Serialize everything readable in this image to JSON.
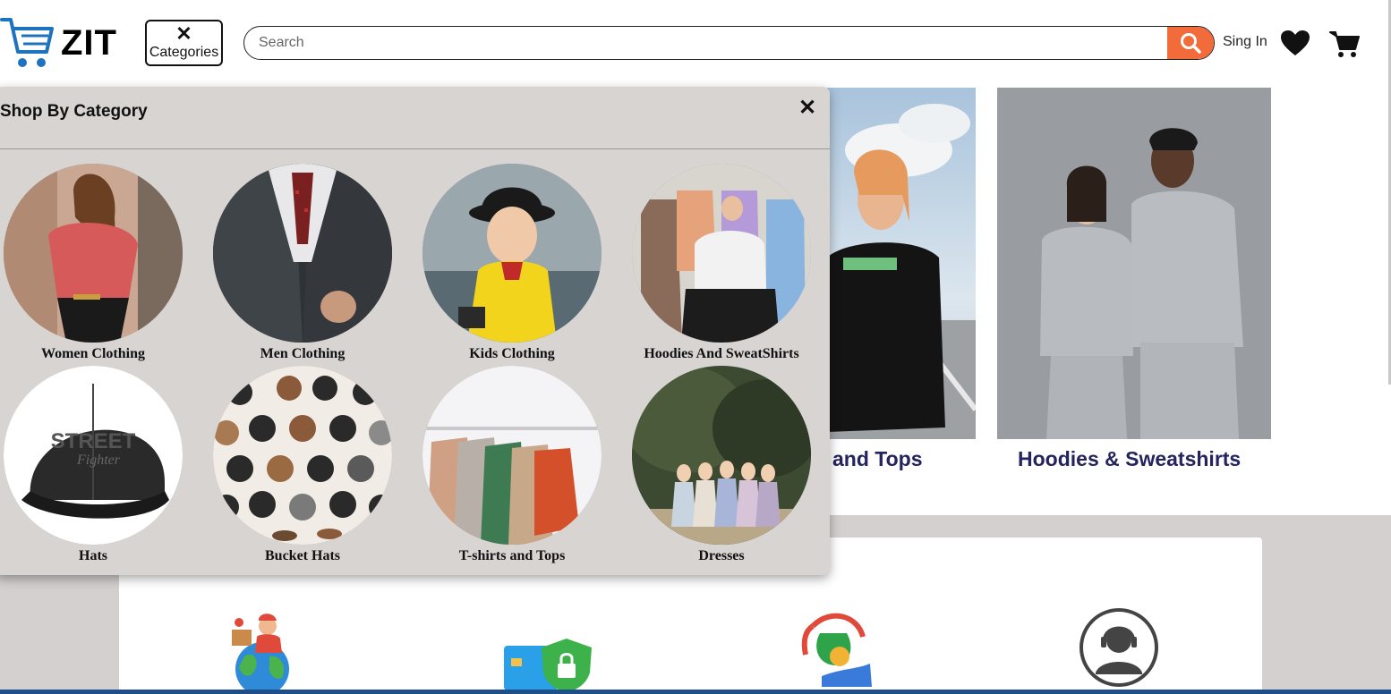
{
  "header": {
    "logo_text": "ZIT",
    "categories_close": "✕",
    "categories_label": "Categories",
    "search_placeholder": "Search",
    "search_value": "",
    "signin_label": "Sing In"
  },
  "background_cards": [
    {
      "title": "and Tops"
    },
    {
      "title": "Hoodies & Sweatshirts"
    }
  ],
  "category_panel": {
    "title": "Shop By Category",
    "close": "✕",
    "items": [
      {
        "label": "Women Clothing"
      },
      {
        "label": "Men Clothing"
      },
      {
        "label": "Kids Clothing"
      },
      {
        "label": "Hoodies And SweatShirts"
      },
      {
        "label": "Hats"
      },
      {
        "label": "Bucket Hats"
      },
      {
        "label": "T-shirts and Tops"
      },
      {
        "label": "Dresses"
      }
    ]
  },
  "hat_print": {
    "line1": "STREET",
    "line2": "Fighter"
  },
  "features": [
    {
      "icon": "delivery-globe-icon"
    },
    {
      "icon": "secure-payment-icon"
    },
    {
      "icon": "money-back-icon"
    },
    {
      "icon": "support-agent-icon"
    }
  ],
  "colors": {
    "accent": "#f26b3a",
    "title_navy": "#24245e",
    "logo_blue": "#1e73be",
    "panel_bg": "#d8d4d2"
  }
}
